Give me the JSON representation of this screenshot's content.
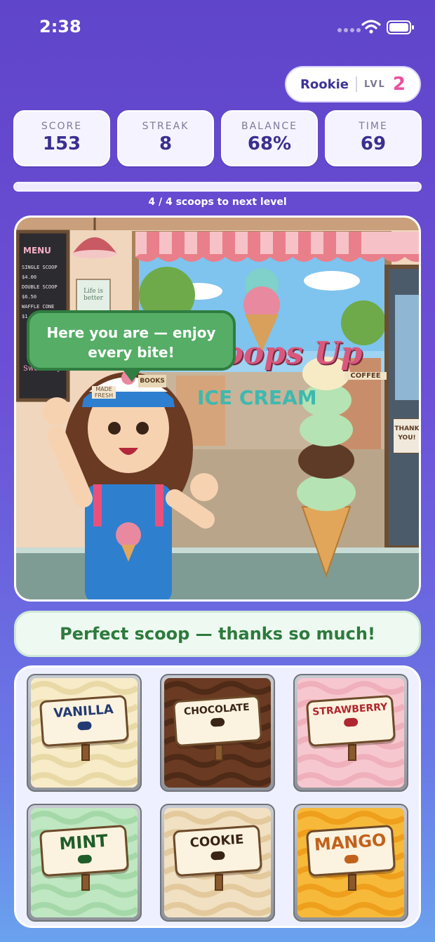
{
  "status_bar": {
    "time": "2:38"
  },
  "level": {
    "rank": "Rookie",
    "lvl_label": "LVL",
    "lvl_value": "2"
  },
  "stats": [
    {
      "label": "SCORE",
      "value": "153"
    },
    {
      "label": "STREAK",
      "value": "8"
    },
    {
      "label": "BALANCE",
      "value": "68%"
    },
    {
      "label": "TIME",
      "value": "69"
    }
  ],
  "progress": {
    "text": "4 / 4 scoops to next level",
    "fraction": 1.0
  },
  "scene": {
    "speech": "Here you are — enjoy every bite!",
    "menu_title": "MENU",
    "menu_items": [
      {
        "name": "SINGLE SCOOP",
        "price": "$4.00"
      },
      {
        "name": "DOUBLE SCOOP",
        "price": "$6.50"
      },
      {
        "name": "WAFFLE CONE",
        "price": "$1.00"
      }
    ],
    "menu_footer": "Sweet Day!",
    "poster_text": "Life is better",
    "shop_sign": "Scoops Up",
    "shop_sign_sub": "ICE CREAM",
    "door_sign": "THANK YOU!",
    "books_sign": "BOOKS",
    "coffee_sign": "COFFEE",
    "made_fresh_sign": "MADE FRESH",
    "cone_scoops": [
      "mint",
      "mint",
      "chocolate",
      "mint",
      "vanilla"
    ]
  },
  "feedback": "Perfect scoop — thanks so much!",
  "flavors": [
    {
      "name": "VANILLA",
      "color": "#f7ebc8",
      "accent": "#e9d9a6",
      "text_color": "#243a73",
      "icon": "🌼"
    },
    {
      "name": "CHOCOLATE",
      "color": "#6a3a22",
      "accent": "#4e2a17",
      "text_color": "#3a2416",
      "icon": "🍫"
    },
    {
      "name": "STRAWBERRY",
      "color": "#f7c7cf",
      "accent": "#efb0bb",
      "text_color": "#b0262f",
      "icon": "🍓"
    },
    {
      "name": "MINT",
      "color": "#bfe7c1",
      "accent": "#a5d8a8",
      "text_color": "#1f5d2a",
      "icon": "🌿"
    },
    {
      "name": "COOKIE",
      "color": "#f1e0c2",
      "accent": "#e3c99c",
      "text_color": "#3a2416",
      "icon": "🍪"
    },
    {
      "name": "MANGO",
      "color": "#f7b93a",
      "accent": "#ee9f1c",
      "text_color": "#c2611a",
      "icon": "🥭"
    }
  ],
  "colors": {
    "accent_pink": "#ec4f9e",
    "speech_green": "#55ad66",
    "feedback_green": "#2d7a3d"
  }
}
